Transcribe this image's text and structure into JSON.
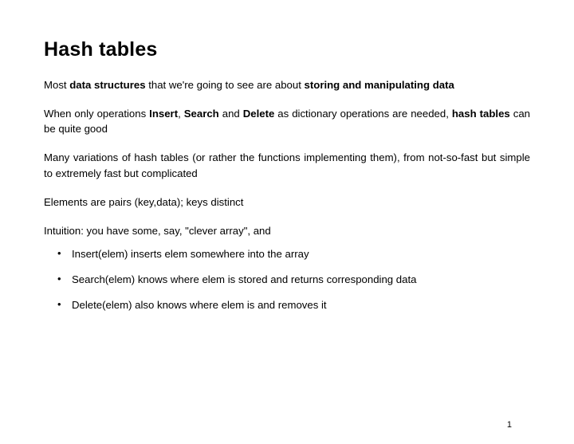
{
  "title": "Hash tables",
  "para1": {
    "t1": "Most ",
    "b1": "data structures",
    "t2": " that we're going to see are about ",
    "b2": "storing and manipulating data"
  },
  "para2": {
    "t1": "When only operations ",
    "b1": "Insert",
    "t2": ", ",
    "b2": "Search",
    "t3": " and ",
    "b3": "Delete",
    "t4": " as dictionary operations are needed, ",
    "b4": "hash tables",
    "t5": " can be quite good"
  },
  "para3": "Many variations of hash tables (or rather the functions implementing them), from not-so-fast but simple to extremely fast but complicated",
  "para4": "Elements are pairs (key,data); keys distinct",
  "para5": "Intuition: you have some, say, \"clever array\", and",
  "bullets": {
    "b1": "Insert(elem) inserts elem somewhere into the array",
    "b2": "Search(elem) knows where elem is stored and returns corresponding data",
    "b3": "Delete(elem) also knows where elem is and removes it"
  },
  "pageNumber": "1"
}
